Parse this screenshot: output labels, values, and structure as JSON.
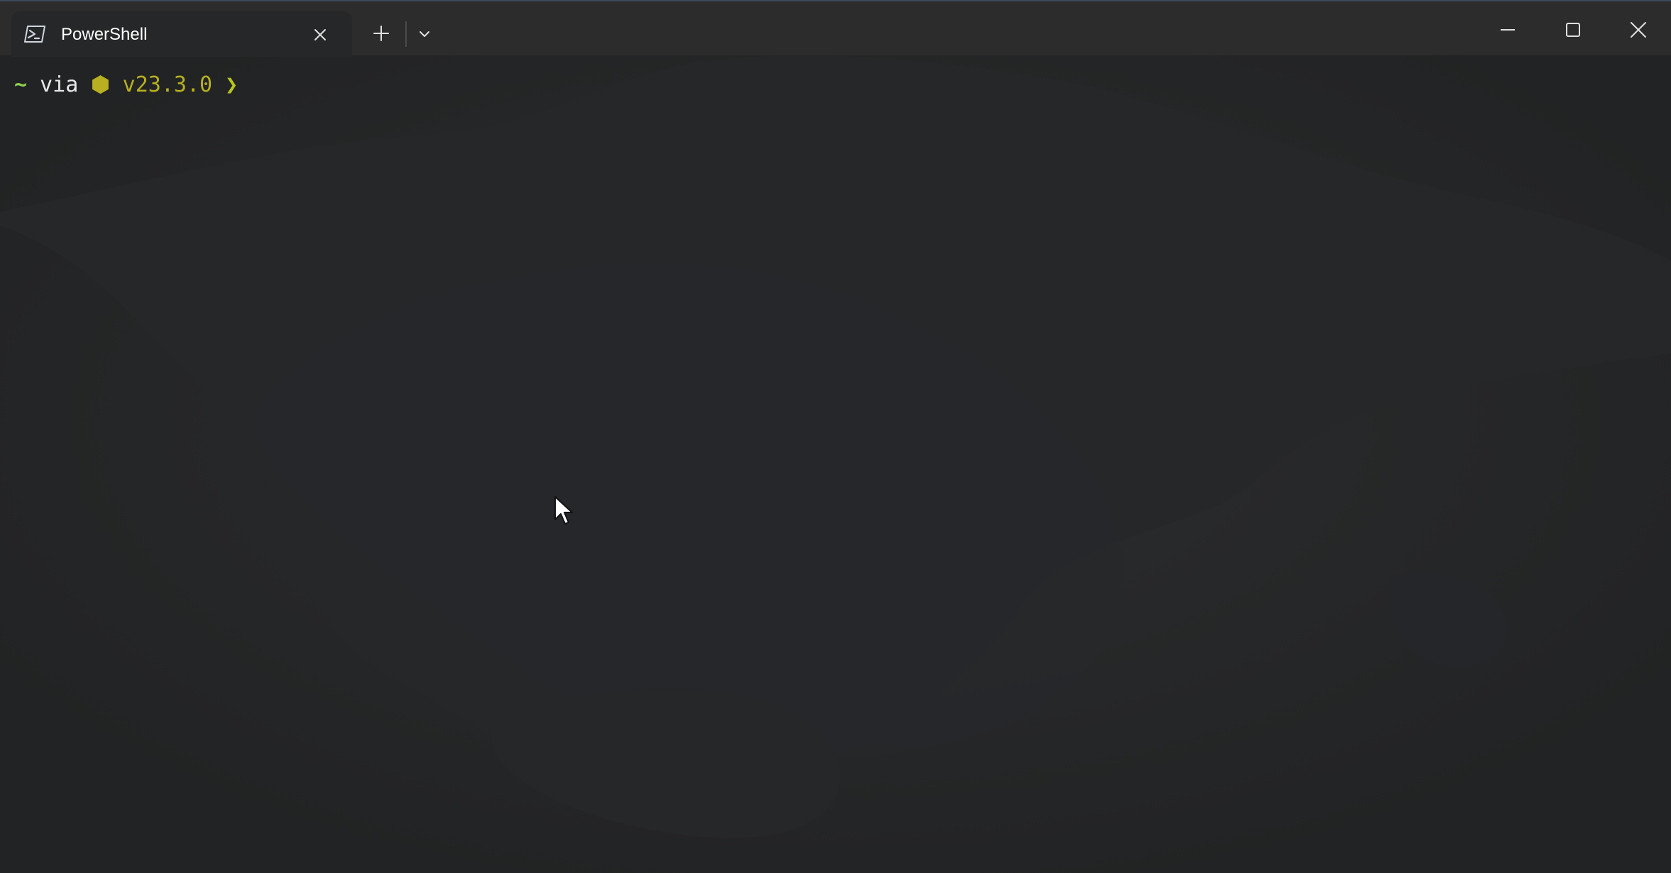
{
  "window": {
    "tab_title": "PowerShell",
    "tab_icon": "powershell-icon",
    "new_tab_icon": "plus-icon",
    "dropdown_icon": "chevron-down-icon",
    "controls": [
      "minimize-icon",
      "maximize-icon",
      "close-icon"
    ]
  },
  "prompt": {
    "tilde": "~",
    "via": "via",
    "node_icon": "⬢",
    "version": "v23.3.0",
    "arrow": "❯"
  },
  "colors": {
    "background": "#242526",
    "titlebar": "#2c2c2c",
    "tilde": "#8fd14f",
    "version": "#b8b020",
    "arrow": "#b8c51f"
  }
}
